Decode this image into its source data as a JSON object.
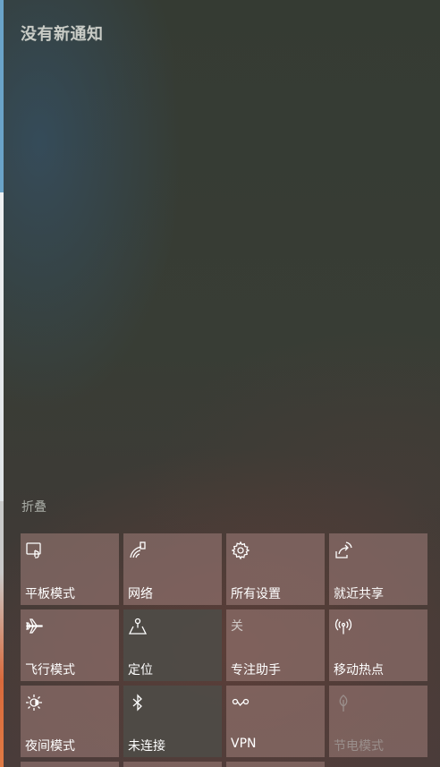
{
  "header": {
    "title": "没有新通知"
  },
  "collapse_label": "折叠",
  "tiles": [
    {
      "label": "平板模式",
      "icon": "tablet-mode-icon",
      "state": "on"
    },
    {
      "label": "网络",
      "icon": "network-icon",
      "state": "on"
    },
    {
      "label": "所有设置",
      "icon": "gear-icon",
      "state": "on"
    },
    {
      "label": "就近共享",
      "icon": "nearby-share-icon",
      "state": "on"
    },
    {
      "label": "飞行模式",
      "icon": "airplane-icon",
      "state": "on"
    },
    {
      "label": "定位",
      "icon": "location-icon",
      "state": "off"
    },
    {
      "label": "专注助手",
      "icon": "focus-assist-icon",
      "icon_text": "关",
      "state": "on"
    },
    {
      "label": "移动热点",
      "icon": "hotspot-icon",
      "state": "on"
    },
    {
      "label": "夜间模式",
      "icon": "night-light-icon",
      "state": "on"
    },
    {
      "label": "未连接",
      "icon": "bluetooth-icon",
      "state": "off"
    },
    {
      "label": "VPN",
      "icon": "vpn-icon",
      "state": "on"
    },
    {
      "label": "节电模式",
      "icon": "battery-saver-icon",
      "state": "disabled"
    }
  ]
}
